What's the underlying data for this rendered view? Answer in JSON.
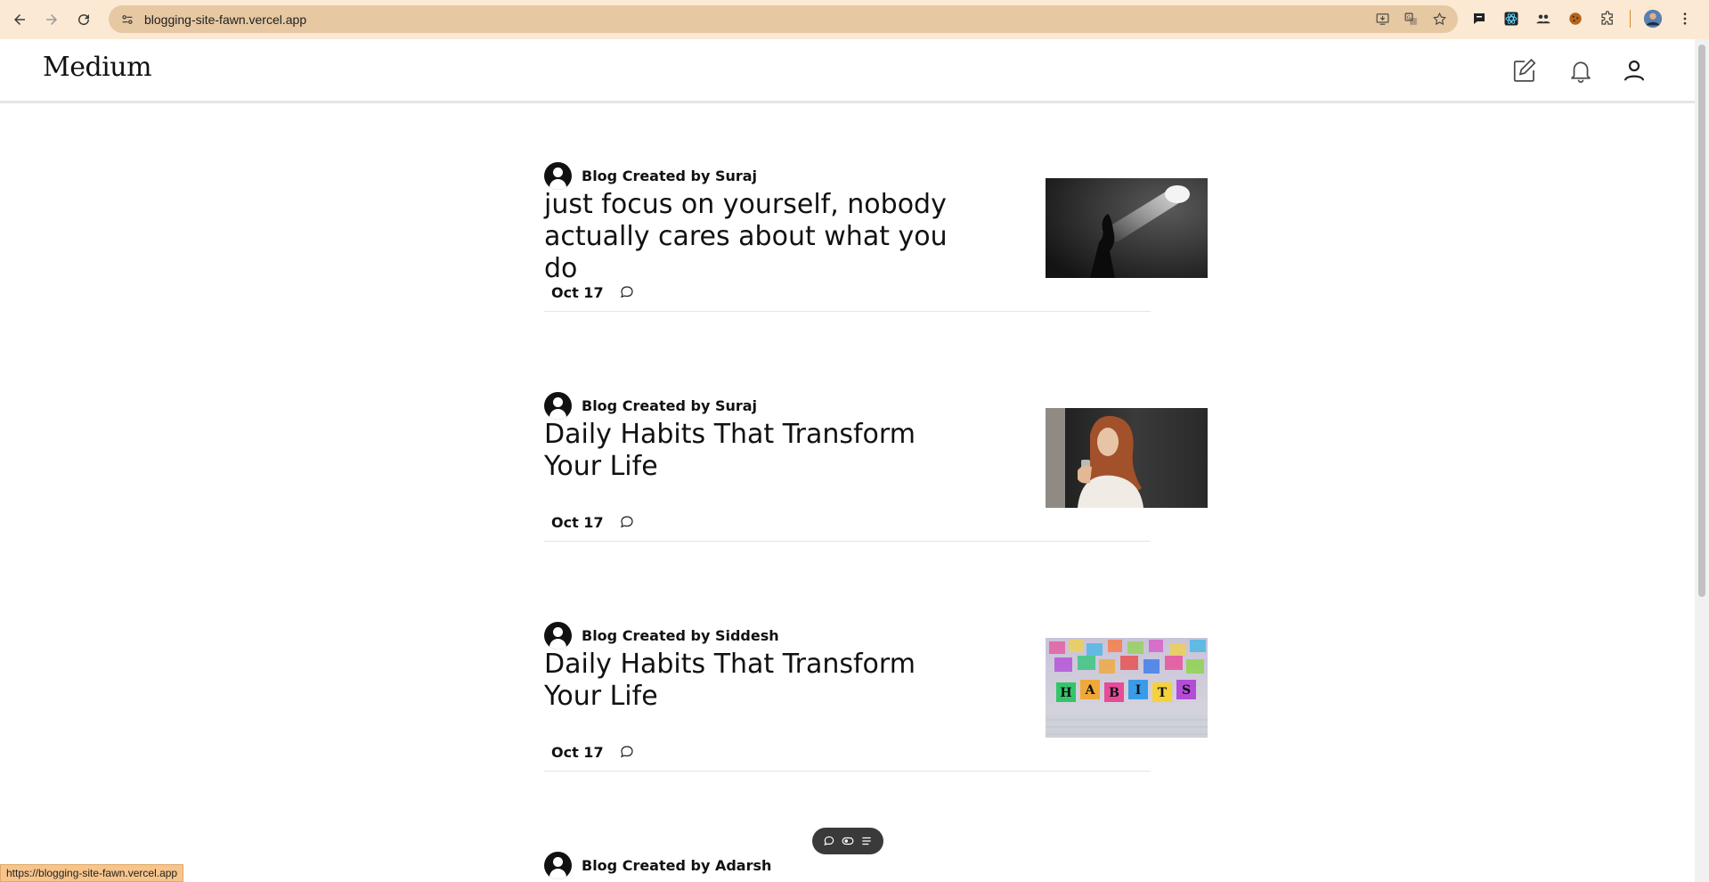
{
  "browser": {
    "url": "blogging-site-fawn.vercel.app",
    "status_url": "https://blogging-site-fawn.vercel.app"
  },
  "site": {
    "logo": "Medium"
  },
  "posts": [
    {
      "author": "Blog Created by Suraj",
      "title": "just focus on yourself, nobody actually cares about what you do",
      "date": "Oct 17",
      "thumb": "dark-spotlight"
    },
    {
      "author": "Blog Created by Suraj",
      "title": "Daily Habits That Transform Your Life",
      "date": "Oct 17",
      "thumb": "woman-drinking"
    },
    {
      "author": "Blog Created by Siddesh",
      "title": "Daily Habits That Transform Your Life",
      "date": "Oct 17",
      "thumb": "habits-blocks"
    },
    {
      "author": "Blog Created by Adarsh"
    }
  ],
  "habits_letters": [
    "H",
    "A",
    "B",
    "I",
    "T",
    "S"
  ],
  "colors": {
    "chrome_bg": "#fbe9d3",
    "omnibox_bg": "#e6c8a2",
    "text": "#111111"
  }
}
